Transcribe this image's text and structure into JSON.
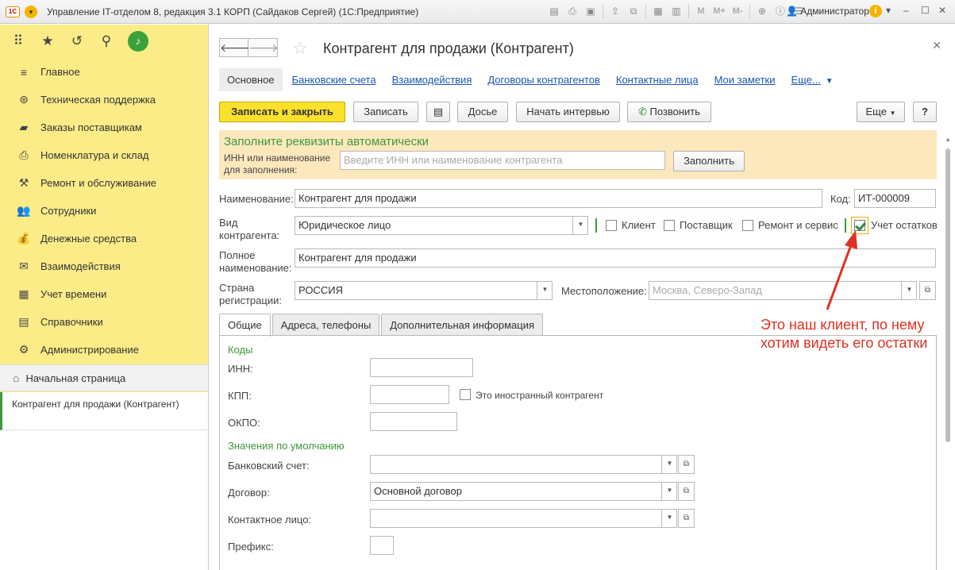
{
  "window": {
    "title": "Управление IT-отделом 8, редакция 3.1 КОРП (Сайдаков Сергей)  (1С:Предприятие)",
    "logo": "1С",
    "user": "Администратор",
    "tools": [
      "save-icon",
      "print-icon",
      "attach-icon",
      "copy-icon",
      "calc-icon",
      "calendar-icon",
      "M",
      "M+",
      "M-",
      "zoom-icon",
      "info-icon",
      "list-icon"
    ]
  },
  "sidebar": {
    "items": [
      {
        "label": "Главное",
        "icon": "menu-icon"
      },
      {
        "label": "Техническая поддержка",
        "icon": "support-icon"
      },
      {
        "label": "Заказы поставщикам",
        "icon": "truck-icon"
      },
      {
        "label": "Номенклатура и склад",
        "icon": "printer-icon"
      },
      {
        "label": "Ремонт и обслуживание",
        "icon": "wrench-icon"
      },
      {
        "label": "Сотрудники",
        "icon": "people-icon"
      },
      {
        "label": "Денежные средства",
        "icon": "money-icon"
      },
      {
        "label": "Взаимодействия",
        "icon": "mail-icon"
      },
      {
        "label": "Учет времени",
        "icon": "calendar-icon"
      },
      {
        "label": "Справочники",
        "icon": "book-icon"
      },
      {
        "label": "Администрирование",
        "icon": "gear-icon"
      }
    ],
    "home": "Начальная страница",
    "current": "Контрагент для продажи (Контрагент)"
  },
  "form": {
    "title": "Контрагент для продажи (Контрагент)",
    "tabs": [
      "Основное",
      "Банковские счета",
      "Взаимодействия",
      "Договоры контрагентов",
      "Контактные лица",
      "Мои заметки",
      "Еще..."
    ],
    "toolbar": {
      "save_close": "Записать и закрыть",
      "save": "Записать",
      "dossier": "Досье",
      "interview": "Начать интервью",
      "call": "Позвонить",
      "more": "Еще",
      "help": "?"
    },
    "autofill": {
      "title": "Заполните реквизиты автоматически",
      "label": "ИНН или наименование для заполнения:",
      "placeholder": "Введите ИНН или наименование контрагента",
      "button": "Заполнить"
    },
    "name_label": "Наименование:",
    "name_value": "Контрагент для продажи",
    "code_label": "Код:",
    "code_value": "ИТ-000009",
    "type_label": "Вид контрагента:",
    "type_value": "Юридическое лицо",
    "checks": [
      {
        "label": "Клиент",
        "checked": false
      },
      {
        "label": "Поставщик",
        "checked": false
      },
      {
        "label": "Ремонт и сервис",
        "checked": false
      },
      {
        "label": "Учет остатков",
        "checked": true
      }
    ],
    "full_name_label": "Полное наименование:",
    "full_name_value": "Контрагент для продажи",
    "country_label": "Страна регистрации:",
    "country_value": "РОССИЯ",
    "location_label": "Местоположение:",
    "location_placeholder": "Москва, Северо-Запад",
    "subtabs": [
      "Общие",
      "Адреса, телефоны",
      "Дополнительная информация"
    ],
    "codes_group": "Коды",
    "inn_label": "ИНН:",
    "kpp_label": "КПП:",
    "foreign_label": "Это иностранный контрагент",
    "okpo_label": "ОКПО:",
    "defaults_group": "Значения по умолчанию",
    "bank_label": "Банковский счет:",
    "contract_label": "Договор:",
    "contract_value": "Основной договор",
    "contact_label": "Контактное лицо:",
    "prefix_label": "Префикс:"
  },
  "annotation": "Это наш клиент, по нему хотим видеть его остатки",
  "colors": {
    "accent_yellow": "#fbe12c",
    "sidebar": "#fbec88",
    "annotation": "#e03020",
    "green": "#3a9a3a"
  }
}
